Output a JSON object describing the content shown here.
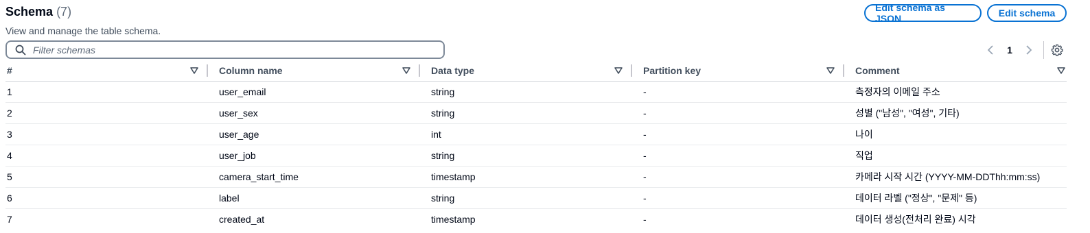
{
  "header": {
    "title": "Schema",
    "count": "(7)",
    "description": "View and manage the table schema."
  },
  "actions": {
    "edit_json_label": "Edit schema as JSON",
    "edit_label": "Edit schema"
  },
  "filter": {
    "placeholder": "Filter schemas",
    "value": ""
  },
  "pagination": {
    "current_page": "1"
  },
  "table": {
    "columns": [
      "#",
      "Column name",
      "Data type",
      "Partition key",
      "Comment"
    ],
    "rows": [
      {
        "num": "1",
        "name": "user_email",
        "type": "string",
        "partition": "-",
        "comment": "측정자의 이메일 주소"
      },
      {
        "num": "2",
        "name": "user_sex",
        "type": "string",
        "partition": "-",
        "comment": "성별 (\"남성\", \"여성\", 기타)"
      },
      {
        "num": "3",
        "name": "user_age",
        "type": "int",
        "partition": "-",
        "comment": "나이"
      },
      {
        "num": "4",
        "name": "user_job",
        "type": "string",
        "partition": "-",
        "comment": "직업"
      },
      {
        "num": "5",
        "name": "camera_start_time",
        "type": "timestamp",
        "partition": "-",
        "comment": "카메라 시작 시간 (YYYY-MM-DDThh:mm:ss)"
      },
      {
        "num": "6",
        "name": "label",
        "type": "string",
        "partition": "-",
        "comment": "데이터 라벨 (\"정상\", \"문제\" 등)"
      },
      {
        "num": "7",
        "name": "created_at",
        "type": "timestamp",
        "partition": "-",
        "comment": "데이터 생성(전처리 완료) 시각"
      }
    ]
  },
  "icons": {
    "search": "search-icon",
    "sort": "caret-down-icon",
    "prev": "chevron-left-icon",
    "next": "chevron-right-icon",
    "settings": "gear-icon"
  },
  "colors": {
    "accent": "#0972d3",
    "text": "#000716",
    "muted": "#5f6b7a"
  }
}
